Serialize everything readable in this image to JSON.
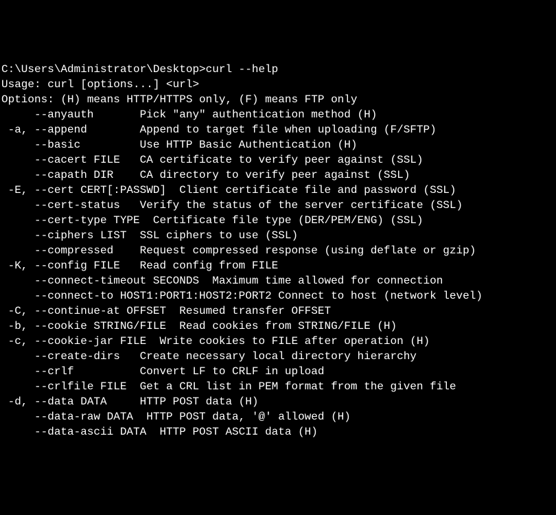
{
  "terminal": {
    "lines": [
      "C:\\Users\\Administrator\\Desktop>curl --help",
      "Usage: curl [options...] <url>",
      "Options: (H) means HTTP/HTTPS only, (F) means FTP only",
      "     --anyauth       Pick \"any\" authentication method (H)",
      " -a, --append        Append to target file when uploading (F/SFTP)",
      "     --basic         Use HTTP Basic Authentication (H)",
      "     --cacert FILE   CA certificate to verify peer against (SSL)",
      "     --capath DIR    CA directory to verify peer against (SSL)",
      " -E, --cert CERT[:PASSWD]  Client certificate file and password (SSL)",
      "     --cert-status   Verify the status of the server certificate (SSL)",
      "     --cert-type TYPE  Certificate file type (DER/PEM/ENG) (SSL)",
      "     --ciphers LIST  SSL ciphers to use (SSL)",
      "     --compressed    Request compressed response (using deflate or gzip)",
      " -K, --config FILE   Read config from FILE",
      "     --connect-timeout SECONDS  Maximum time allowed for connection",
      "     --connect-to HOST1:PORT1:HOST2:PORT2 Connect to host (network level)",
      " -C, --continue-at OFFSET  Resumed transfer OFFSET",
      " -b, --cookie STRING/FILE  Read cookies from STRING/FILE (H)",
      " -c, --cookie-jar FILE  Write cookies to FILE after operation (H)",
      "     --create-dirs   Create necessary local directory hierarchy",
      "     --crlf          Convert LF to CRLF in upload",
      "     --crlfile FILE  Get a CRL list in PEM format from the given file",
      " -d, --data DATA     HTTP POST data (H)",
      "     --data-raw DATA  HTTP POST data, '@' allowed (H)",
      "     --data-ascii DATA  HTTP POST ASCII data (H)"
    ]
  }
}
